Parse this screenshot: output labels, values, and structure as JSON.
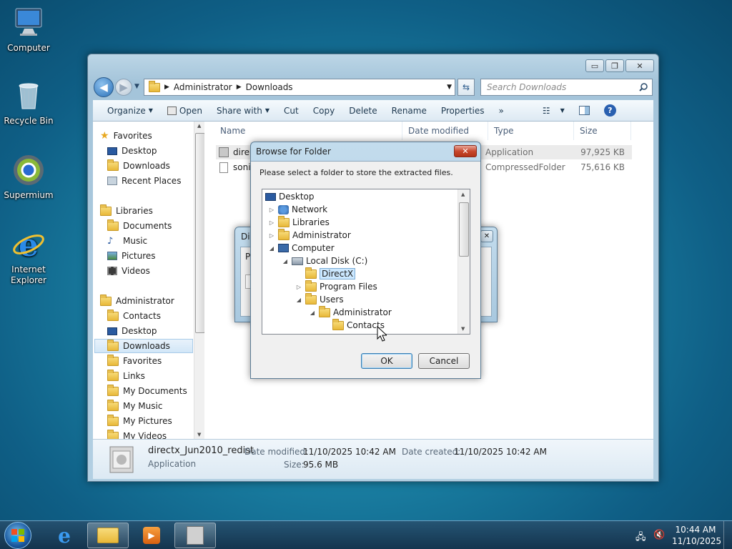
{
  "desktop": {
    "icons": [
      {
        "label": "Computer"
      },
      {
        "label": "Recycle Bin"
      },
      {
        "label": "Supermium"
      },
      {
        "label": "Internet Explorer"
      }
    ]
  },
  "explorer": {
    "address": {
      "segments": [
        "Administrator",
        "Downloads"
      ]
    },
    "search": {
      "placeholder": "Search Downloads"
    },
    "toolbar": {
      "organize": "Organize",
      "open": "Open",
      "share_with": "Share with",
      "cut": "Cut",
      "copy": "Copy",
      "delete": "Delete",
      "rename": "Rename",
      "properties": "Properties",
      "more": "»"
    },
    "nav": {
      "favorites": {
        "label": "Favorites",
        "items": [
          "Desktop",
          "Downloads",
          "Recent Places"
        ]
      },
      "libraries": {
        "label": "Libraries",
        "items": [
          "Documents",
          "Music",
          "Pictures",
          "Videos"
        ]
      },
      "administrator": {
        "label": "Administrator",
        "items": [
          "Contacts",
          "Desktop",
          "Downloads",
          "Favorites",
          "Links",
          "My Documents",
          "My Music",
          "My Pictures",
          "My Videos"
        ]
      }
    },
    "columns": {
      "name": "Name",
      "date": "Date modified",
      "type": "Type",
      "size": "Size"
    },
    "files": [
      {
        "name": "dire",
        "type": "Application",
        "size": "97,925 KB"
      },
      {
        "name": "soni",
        "type": "CompressedFolder",
        "size": "75,616 KB"
      }
    ],
    "details": {
      "filename": "directx_Jun2010_redist",
      "date_modified_label": "Date modified:",
      "date_modified": "11/10/2025 10:42 AM",
      "date_created_label": "Date created:",
      "date_created": "11/10/2025 10:42 AM",
      "type": "Application",
      "size_label": "Size:",
      "size": "95.6 MB"
    }
  },
  "bg_dialog": {
    "title": "Dir",
    "text": "Pl"
  },
  "browse_dialog": {
    "title": "Browse for Folder",
    "prompt": "Please select a folder to store the extracted files.",
    "tree": [
      "Desktop",
      "Network",
      "Libraries",
      "Administrator",
      "Computer",
      "Local Disk (C:)",
      "DirectX",
      "Program Files",
      "Users",
      "Administrator",
      "Contacts"
    ],
    "ok": "OK",
    "cancel": "Cancel"
  },
  "taskbar": {
    "time": "10:44 AM",
    "date": "11/10/2025"
  },
  "colors": {
    "accent": "#1c86a8",
    "selection": "#cce8ff"
  }
}
